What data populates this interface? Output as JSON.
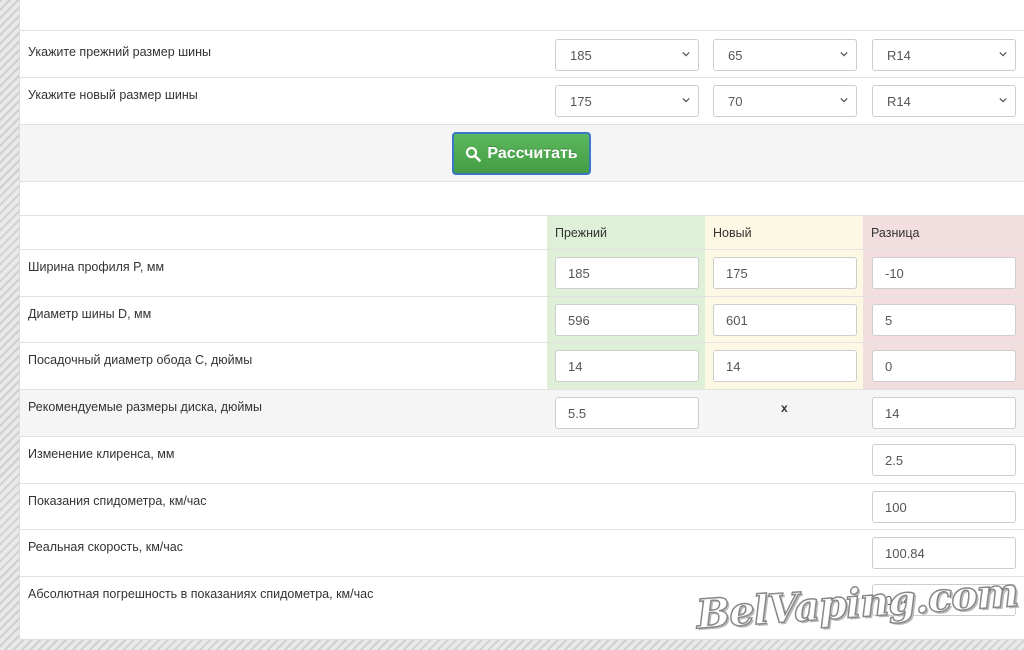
{
  "inputs": {
    "old_label": "Укажите прежний размер шины",
    "new_label": "Укажите новый размер шины",
    "old": {
      "width": "185",
      "profile": "65",
      "rim": "R14"
    },
    "new": {
      "width": "175",
      "profile": "70",
      "rim": "R14"
    }
  },
  "calc_button": "Рассчитать",
  "table": {
    "headers": {
      "old": "Прежний",
      "new": "Новый",
      "diff": "Разница"
    },
    "rows": [
      {
        "label": "Ширина профиля P, мм",
        "old": "185",
        "new": "175",
        "diff": "-10"
      },
      {
        "label": "Диаметр шины D, мм",
        "old": "596",
        "new": "601",
        "diff": "5"
      },
      {
        "label": "Посадочный диаметр обода C, дюймы",
        "old": "14",
        "new": "14",
        "diff": "0"
      }
    ],
    "rim_reco": {
      "label": "Рекомендуемые размеры диска, дюймы",
      "width": "5.5",
      "sep": "x",
      "diameter": "14"
    },
    "clearance": {
      "label": "Изменение клиренса, мм",
      "value": "2.5"
    },
    "speedo": {
      "label": "Показания спидометра, км/час",
      "value": "100"
    },
    "real_speed": {
      "label": "Реальная скорость, км/час",
      "value": "100.84"
    },
    "abs_error": {
      "label": "Абсолютная погрешность в показаниях спидометра, км/час",
      "value": "0.84"
    }
  },
  "watermark": "BelVaping.com",
  "colors": {
    "button": "#5cb85c",
    "old_col": "#dff0d8",
    "new_col": "#fcf8e3",
    "diff_col": "#f2dede"
  }
}
